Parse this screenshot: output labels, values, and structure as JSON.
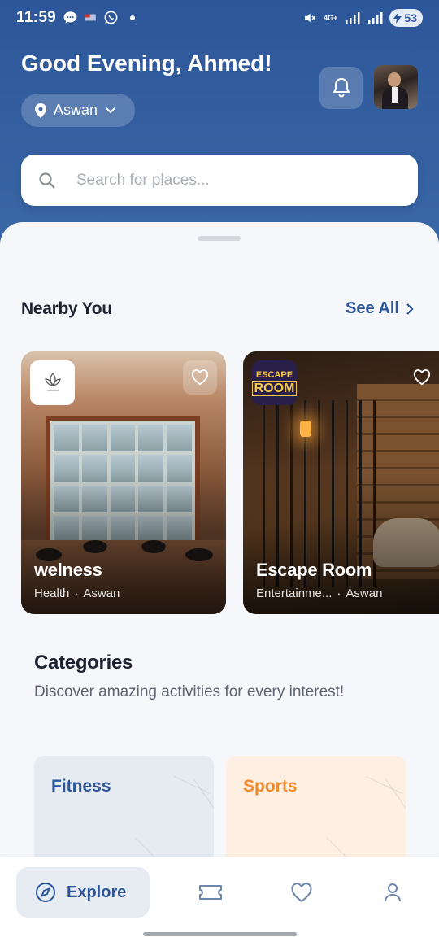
{
  "status_bar": {
    "time": "11:59",
    "battery": "53",
    "network": "4G+"
  },
  "header": {
    "greeting": "Good Evening, Ahmed!",
    "location": "Aswan"
  },
  "search": {
    "placeholder": "Search for places..."
  },
  "nearby": {
    "title": "Nearby You",
    "see_all": "See All",
    "cards": [
      {
        "title": "welness",
        "category": "Health",
        "location": "Aswan",
        "logo_text": ""
      },
      {
        "title": "Escape Room",
        "category": "Entertainme...",
        "location": "Aswan",
        "logo_top": "ESCAPE",
        "logo_bottom": "ROOM"
      }
    ]
  },
  "categories": {
    "title": "Categories",
    "subtitle": "Discover amazing activities for every interest!",
    "items": [
      {
        "label": "Fitness",
        "color": "#2c5699"
      },
      {
        "label": "Sports",
        "color": "#f08a2a"
      }
    ]
  },
  "bottom_nav": {
    "explore_label": "Explore",
    "items": [
      "compass-icon",
      "ticket-icon",
      "heart-icon",
      "user-icon"
    ]
  },
  "colors": {
    "primary": "#2c5699",
    "accent": "#f08a2a",
    "background": "#f5f7fa"
  }
}
